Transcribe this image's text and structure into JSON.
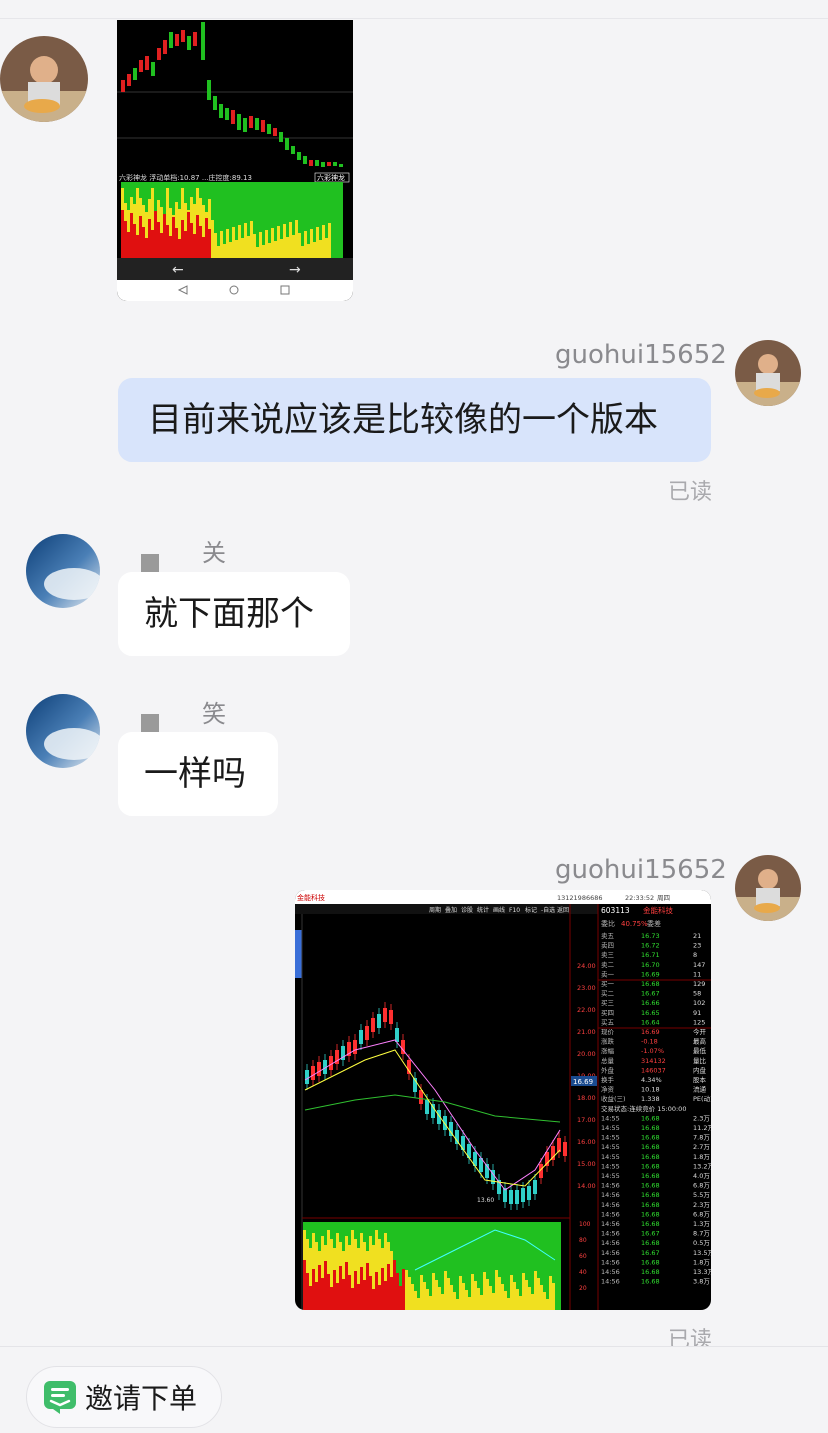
{
  "messages": [
    {
      "sender": "guohui15652",
      "text": "目前来说应该是比较像的一个版本",
      "status": "已读"
    },
    {
      "sender_suffix": "关",
      "text": "就下面那个"
    },
    {
      "sender_suffix": "笑",
      "text": "一样吗"
    },
    {
      "sender": "guohui15652",
      "status": "已读",
      "image_caption": "stock-chart-screenshot"
    }
  ],
  "chart1": {
    "footer_text": "六彩神龙 浮动单档:10.87 ...庄控度:89.13",
    "badge": "六彩神龙"
  },
  "chart2": {
    "stock_name": "金能科技",
    "stock_code": "603113",
    "phone": "13121986686",
    "time": "22:33:52",
    "weekday": "周四",
    "price_levels": [
      "24.00",
      "23.00",
      "22.00",
      "21.00",
      "20.00",
      "19.00",
      "18.00",
      "17.00",
      "16.00",
      "15.00",
      "14.00"
    ],
    "current_label": "16.69",
    "weibi": "40.75%",
    "weicha": "委差",
    "sell_rows": [
      [
        "卖五",
        "16.73",
        "21"
      ],
      [
        "卖四",
        "16.72",
        "23"
      ],
      [
        "卖三",
        "16.71",
        "8"
      ],
      [
        "卖二",
        "16.70",
        "147"
      ],
      [
        "卖一",
        "16.69",
        "11"
      ]
    ],
    "buy_rows": [
      [
        "买一",
        "16.68",
        "129"
      ],
      [
        "买二",
        "16.67",
        "58"
      ],
      [
        "买三",
        "16.66",
        "102"
      ],
      [
        "买四",
        "16.65",
        "91"
      ],
      [
        "买五",
        "16.64",
        "125"
      ]
    ],
    "stats": [
      [
        "现价",
        "16.69",
        "今开"
      ],
      [
        "涨跌",
        "-0.18",
        "最高"
      ],
      [
        "涨幅",
        "-1.07%",
        "最低"
      ],
      [
        "总量",
        "314132",
        "量比"
      ],
      [
        "外盘",
        "146037",
        "内盘"
      ]
    ],
    "stats2": [
      [
        "换手",
        "4.34%",
        "股本"
      ],
      [
        "净资",
        "10.18",
        "流通"
      ],
      [
        "收益(三)",
        "1.338",
        "PE(动)"
      ]
    ],
    "trade_status": "交易状态:连续竞价 15:00:00",
    "ticks": [
      [
        "14:55",
        "16.68",
        "2.3万"
      ],
      [
        "14:55",
        "16.68",
        "11.2万"
      ],
      [
        "14:55",
        "16.68",
        "7.8万"
      ],
      [
        "14:55",
        "16.68",
        "2.7万"
      ],
      [
        "14:55",
        "16.68",
        "1.8万"
      ],
      [
        "14:55",
        "16.68",
        "13.2万"
      ],
      [
        "14:55",
        "16.68",
        "4.0万"
      ],
      [
        "14:56",
        "16.68",
        "6.8万"
      ],
      [
        "14:56",
        "16.68",
        "5.5万"
      ],
      [
        "14:56",
        "16.68",
        "2.3万"
      ],
      [
        "14:56",
        "16.68",
        "6.8万"
      ],
      [
        "14:56",
        "16.68",
        "1.3万"
      ],
      [
        "14:56",
        "16.67",
        "8.7万"
      ],
      [
        "14:56",
        "16.68",
        "0.5万"
      ],
      [
        "14:56",
        "16.67",
        "13.5万"
      ],
      [
        "14:56",
        "16.68",
        "1.8万"
      ],
      [
        "14:56",
        "16.68",
        "13.3万"
      ],
      [
        "14:56",
        "16.68",
        "3.8万"
      ]
    ],
    "tabs": [
      "周期",
      "叠加",
      "诊股",
      "统计",
      "画线",
      "F10",
      "标记",
      "-自选",
      "返回"
    ],
    "low_label": "13.60",
    "vol_levels": [
      "100",
      "80",
      "60",
      "40",
      "20"
    ]
  },
  "invite": {
    "label": "邀请下单"
  },
  "colors": {
    "self_bubble": "#d8e4fb",
    "other_bubble": "#ffffff",
    "up": "#ff3030",
    "down": "#30d0c8"
  }
}
